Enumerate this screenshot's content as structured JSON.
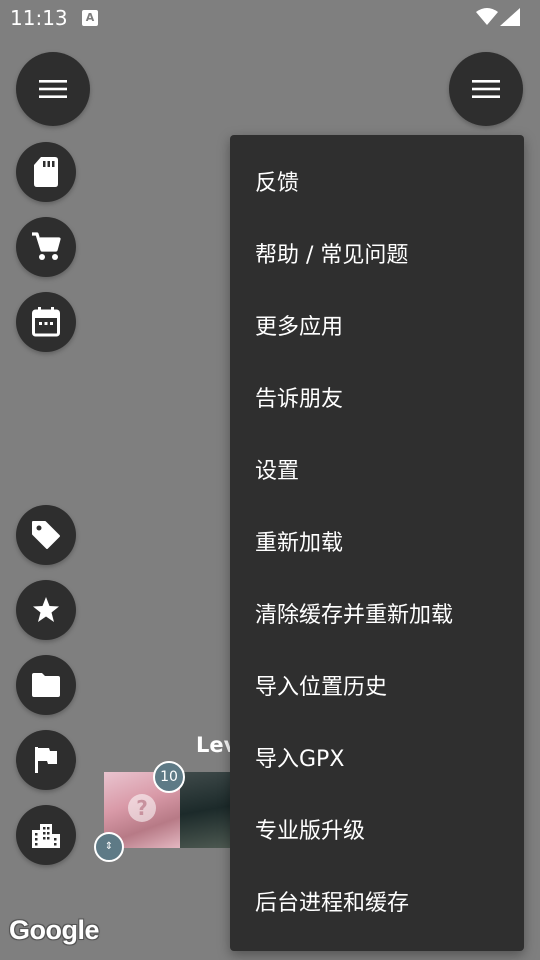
{
  "status_bar": {
    "time": "11:13",
    "notification_icon": "A"
  },
  "fabs": {
    "left_menu_icon": "menu-icon",
    "right_menu_icon": "menu-icon",
    "sd_card_icon": "sd-card-icon",
    "cart_icon": "cart-icon",
    "calendar_icon": "calendar-icon",
    "tag_icon": "tag-icon",
    "star_icon": "star-icon",
    "folder_icon": "folder-icon",
    "flag_icon": "flag-icon",
    "building_icon": "building-icon"
  },
  "map": {
    "label": "Lev",
    "cluster_count": "10",
    "small_badge": "⇕",
    "photo_marker": "?",
    "attribution": "Google"
  },
  "menu": {
    "items": [
      "反馈",
      "帮助 / 常见问题",
      "更多应用",
      "告诉朋友",
      "设置",
      "重新加载",
      "清除缓存并重新加载",
      "导入位置历史",
      "导入GPX",
      "专业版升级",
      "后台进程和缓存"
    ]
  },
  "colors": {
    "background": "#7f7f7f",
    "fab": "#2e2e2e",
    "menu": "#2f2f2f",
    "badge": "#5e7a86"
  }
}
